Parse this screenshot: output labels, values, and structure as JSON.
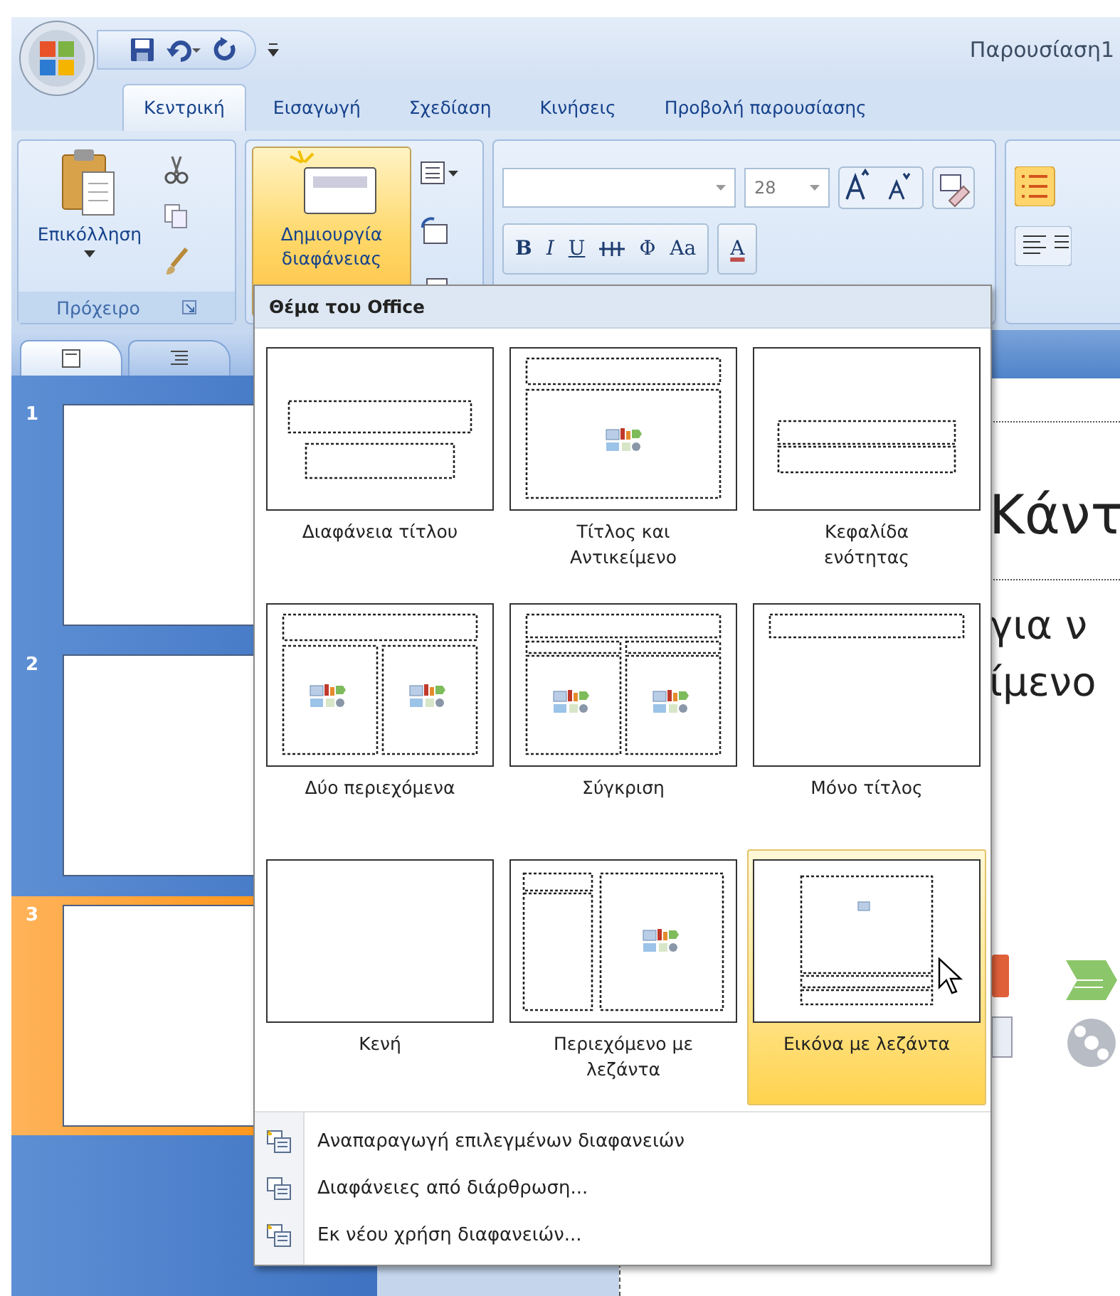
{
  "window": {
    "title": "Παρουσίαση1"
  },
  "tabs": [
    {
      "label": "Κεντρική",
      "selected": true
    },
    {
      "label": "Εισαγωγή",
      "selected": false
    },
    {
      "label": "Σχεδίαση",
      "selected": false
    },
    {
      "label": "Κινήσεις",
      "selected": false
    },
    {
      "label": "Προβολή παρουσίασης",
      "selected": false
    }
  ],
  "clipboard": {
    "paste_label": "Επικόλληση",
    "group_label": "Πρόχειρο"
  },
  "new_slide": {
    "label": "Δημιουργία\nδιαφάνειας",
    "pressed": true
  },
  "font": {
    "size": "28",
    "buttons": [
      "B",
      "I",
      "U",
      "Φ",
      "Aa",
      "A"
    ]
  },
  "slide_panel": {
    "tabs": [
      {
        "selected": true
      },
      {
        "selected": false
      }
    ],
    "thumbnails": [
      {
        "number": "1",
        "selected": false
      },
      {
        "number": "2",
        "selected": false
      },
      {
        "number": "3",
        "selected": true
      }
    ]
  },
  "slide": {
    "title_fragment": "Κάντ",
    "body_fragments": [
      "για ν",
      "ίμενο"
    ]
  },
  "layout_menu": {
    "heading": "Θέμα του Office",
    "layouts": [
      {
        "label": "Διαφάνεια τίτλου",
        "kind": "title",
        "selected": false
      },
      {
        "label": "Τίτλος και\nΑντικείμενο",
        "kind": "title-content",
        "selected": false
      },
      {
        "label": "Κεφαλίδα\nενότητας",
        "kind": "section",
        "selected": false
      },
      {
        "label": "Δύο περιεχόμενα",
        "kind": "two-content",
        "selected": false
      },
      {
        "label": "Σύγκριση",
        "kind": "comparison",
        "selected": false
      },
      {
        "label": "Μόνο τίτλος",
        "kind": "title-only",
        "selected": false
      },
      {
        "label": "Κενή",
        "kind": "blank",
        "selected": false
      },
      {
        "label": "Περιεχόμενο με\nλεζάντα",
        "kind": "content-caption",
        "selected": false
      },
      {
        "label": "Εικόνα με λεζάντα",
        "kind": "picture-caption",
        "selected": true
      }
    ],
    "items": [
      "Αναπαραγωγή επιλεγμένων διαφανειών",
      "Διαφάνειες από διάρθρωση...",
      "Εκ νέου χρήση διαφανειών..."
    ]
  }
}
